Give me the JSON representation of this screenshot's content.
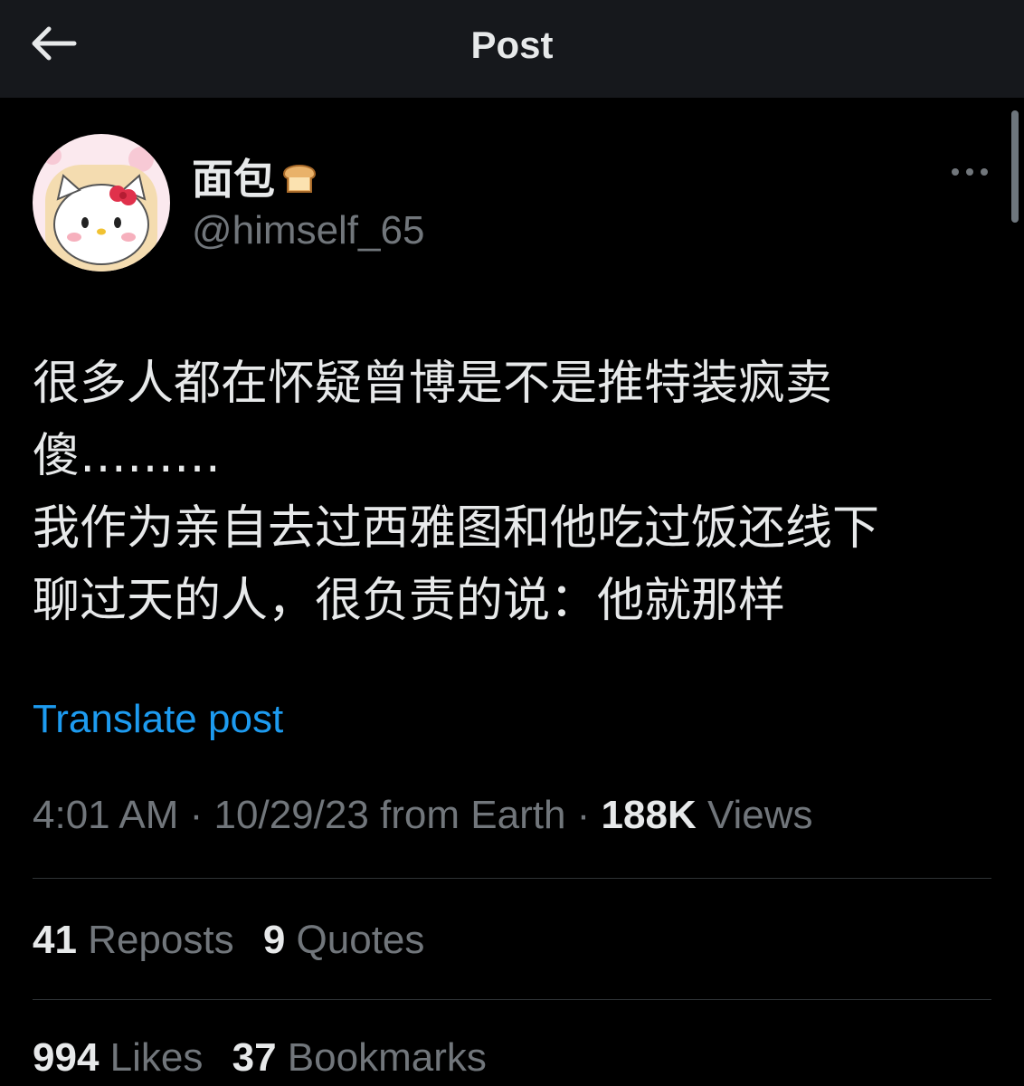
{
  "header": {
    "title": "Post",
    "back_icon": "arrow-left-icon"
  },
  "author": {
    "display_name": "面包",
    "name_emoji_icon": "bread-icon",
    "handle": "@himself_65",
    "avatar": "hello-kitty-avatar",
    "more_icon": "more-horizontal-icon"
  },
  "post": {
    "lines": [
      "很多人都在怀疑曾博是不是推特装疯卖",
      "傻………",
      "我作为亲自去过西雅图和他吃过饭还线下",
      "聊过天的人，很负责的说：他就那样"
    ],
    "translate_label": "Translate post"
  },
  "meta": {
    "time": "4:01 AM",
    "sep1": " · ",
    "date_location": "10/29/23 from Earth",
    "sep2": " · ",
    "views_count": "188K",
    "views_label": " Views"
  },
  "stats_row1": {
    "reposts_count": "41",
    "reposts_label": " Reposts",
    "quotes_count": "9",
    "quotes_label": " Quotes"
  },
  "stats_row2": {
    "likes_count": "994",
    "likes_label": " Likes",
    "bookmarks_count": "37",
    "bookmarks_label": " Bookmarks"
  },
  "colors": {
    "background": "#000000",
    "topbar": "#16181c",
    "text": "#e7e9ea",
    "muted": "#71767b",
    "link": "#1d9bf0",
    "divider": "#2f3336"
  }
}
